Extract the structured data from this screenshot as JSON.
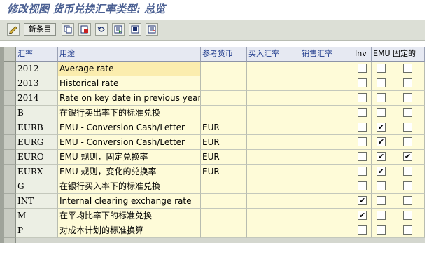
{
  "title": "修改视图 货币兑换汇率类型: 总览",
  "toolbar": {
    "new_entries_label": "新条目",
    "icons": [
      "glasses-icon",
      "copy-icon",
      "delete-icon",
      "undo-icon",
      "select-all-icon",
      "select-block-icon",
      "deselect-all-icon"
    ]
  },
  "table": {
    "headers": {
      "rate": "汇率",
      "usage": "用途",
      "ref_curr": "参考货币",
      "buy_rate": "买入汇率",
      "sell_rate": "销售汇率",
      "inv": "Inv",
      "emu": "EMU",
      "fixed": "固定的"
    },
    "rows": [
      {
        "rate": "2012",
        "usage": "Average rate",
        "ref_curr": "",
        "buy_rate": "",
        "sell_rate": "",
        "inv": false,
        "emu": false,
        "fixed": false
      },
      {
        "rate": "2013",
        "usage": "Historical rate",
        "ref_curr": "",
        "buy_rate": "",
        "sell_rate": "",
        "inv": false,
        "emu": false,
        "fixed": false
      },
      {
        "rate": "2014",
        "usage": "Rate on key date in previous year",
        "ref_curr": "",
        "buy_rate": "",
        "sell_rate": "",
        "inv": false,
        "emu": false,
        "fixed": false
      },
      {
        "rate": "B",
        "usage": "在银行卖出率下的标准兑换",
        "ref_curr": "",
        "buy_rate": "",
        "sell_rate": "",
        "inv": false,
        "emu": false,
        "fixed": false
      },
      {
        "rate": "EURB",
        "usage": "EMU - Conversion Cash/Letter",
        "ref_curr": "EUR",
        "buy_rate": "",
        "sell_rate": "",
        "inv": false,
        "emu": true,
        "fixed": false
      },
      {
        "rate": "EURG",
        "usage": "EMU - Conversion Cash/Letter",
        "ref_curr": "EUR",
        "buy_rate": "",
        "sell_rate": "",
        "inv": false,
        "emu": true,
        "fixed": false
      },
      {
        "rate": "EURO",
        "usage": "EMU 规则，固定兑换率",
        "ref_curr": "EUR",
        "buy_rate": "",
        "sell_rate": "",
        "inv": false,
        "emu": true,
        "fixed": true
      },
      {
        "rate": "EURX",
        "usage": "EMU 规则，变化的兑换率",
        "ref_curr": "EUR",
        "buy_rate": "",
        "sell_rate": "",
        "inv": false,
        "emu": true,
        "fixed": false
      },
      {
        "rate": "G",
        "usage": "在银行买入率下的标准兑换",
        "ref_curr": "",
        "buy_rate": "",
        "sell_rate": "",
        "inv": false,
        "emu": false,
        "fixed": false
      },
      {
        "rate": "INT",
        "usage": "Internal clearing exchange rate",
        "ref_curr": "",
        "buy_rate": "",
        "sell_rate": "",
        "inv": true,
        "emu": false,
        "fixed": false
      },
      {
        "rate": "M",
        "usage": "在平均比率下的标准兑换",
        "ref_curr": "",
        "buy_rate": "",
        "sell_rate": "",
        "inv": true,
        "emu": false,
        "fixed": false
      },
      {
        "rate": "P",
        "usage": "对成本计划的标准换算",
        "ref_curr": "",
        "buy_rate": "",
        "sell_rate": "",
        "inv": false,
        "emu": false,
        "fixed": false
      }
    ]
  },
  "colors": {
    "title": "#4a5f92",
    "header_text": "#1e3a8c",
    "editable_cell": "#fefbd8",
    "key_cell": "#ecefe4"
  }
}
